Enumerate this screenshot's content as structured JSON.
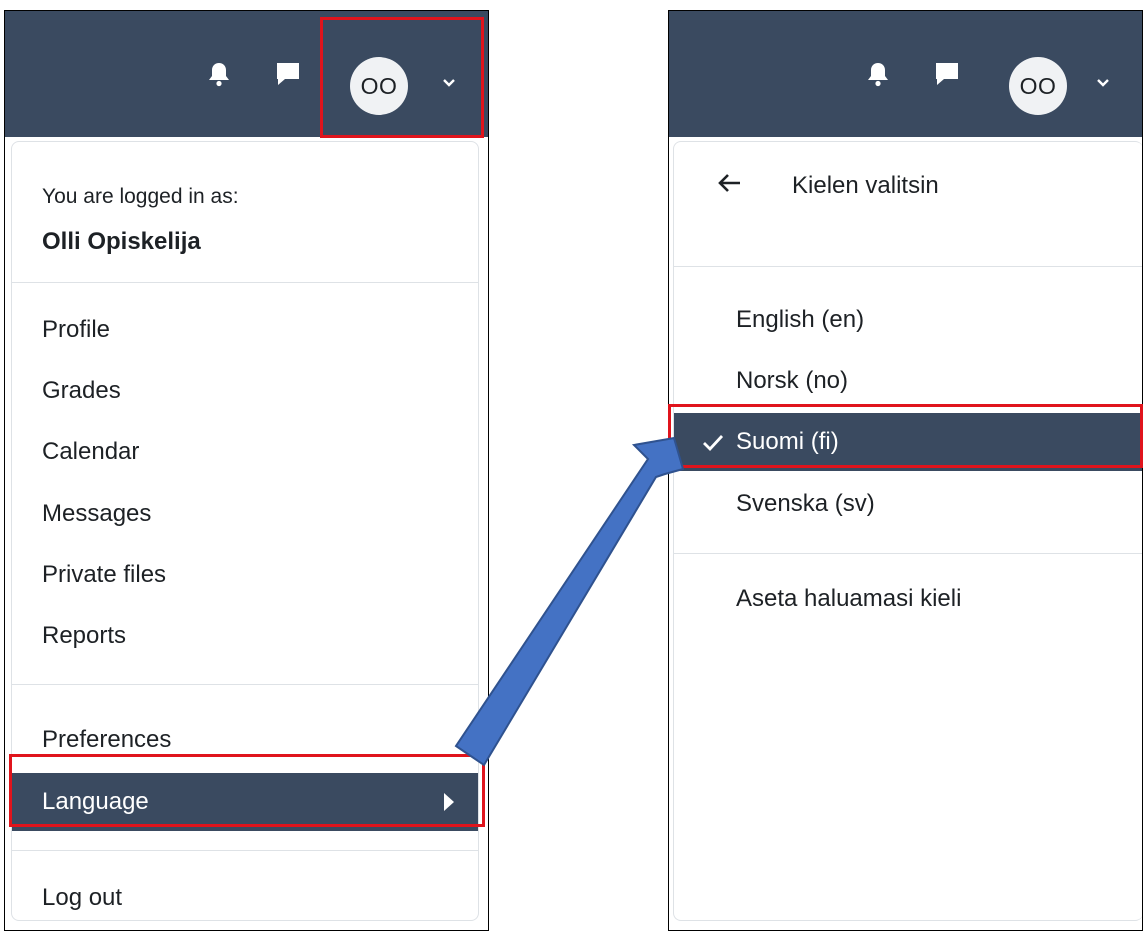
{
  "left_panel": {
    "avatar_initials": "OO",
    "logged_in_label": "You are logged in as:",
    "user_name": "Olli Opiskelija",
    "menu_group_1": [
      "Profile",
      "Grades",
      "Calendar",
      "Messages",
      "Private files",
      "Reports"
    ],
    "menu_group_2": [
      "Preferences",
      "Language"
    ],
    "logout_label": "Log out",
    "active_item": "Language"
  },
  "right_panel": {
    "avatar_initials": "OO",
    "submenu_title": "Kielen valitsin",
    "languages": [
      "English (en)",
      "Norsk (no)",
      "Suomi (fi)",
      "Svenska (sv)"
    ],
    "selected_language": "Suomi (fi)",
    "preferred_language_link": "Aseta haluamasi kieli"
  },
  "icons": {
    "notifications": "bell-icon",
    "messages": "chat-bubble-icon",
    "user_menu_toggle": "chevron-down-icon",
    "submenu": "caret-right-icon",
    "back": "arrow-left-icon",
    "selected": "check-icon"
  },
  "colors": {
    "navbar_bg": "#3a4a60",
    "active_item_bg": "#3a4a60",
    "highlight_border": "#e0141c",
    "connector_arrow": "#4472c4"
  }
}
